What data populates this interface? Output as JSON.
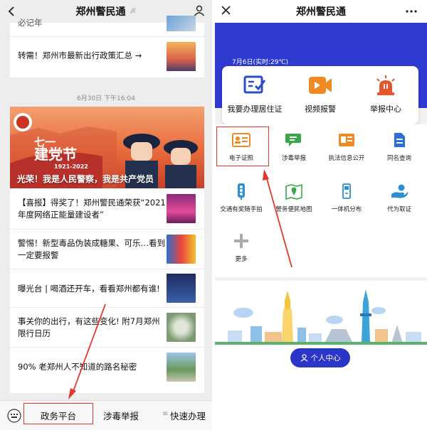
{
  "left": {
    "title": "郑州警民通",
    "partial_item": "必记年",
    "top_item": "转需！郑州市最新出行政策汇总 →",
    "timestamp": "6月30日 下午16:04",
    "banner": {
      "years": "1921-2022",
      "caption": "光荣！我是人民警察，我是共产党员"
    },
    "articles": [
      {
        "text": "【喜报】得奖了！郑州警民通荣获“2021年度网络正能量建设者”"
      },
      {
        "text": "警惕！新型毒品伪装成糖果、可乐…看到一定要报警"
      },
      {
        "text": "曝光台 | 喝酒还开车，看看郑州都有谁!"
      },
      {
        "text": "事关你的出行，有这些变化! 附7月郑州限行日历"
      },
      {
        "text": "90% 老郑州人不知道的路名秘密"
      }
    ],
    "bottom": {
      "item1": "政务平台",
      "item2": "涉毒举报",
      "item3": "快速办理"
    }
  },
  "right": {
    "title": "郑州警民通",
    "weather": "7月6日(实时:29℃)",
    "quick": [
      {
        "label": "我要办理居住证",
        "icon": "id-check-icon"
      },
      {
        "label": "视频报警",
        "icon": "video-camera-icon"
      },
      {
        "label": "举报中心",
        "icon": "alarm-light-icon"
      }
    ],
    "grid": [
      {
        "label": "电子证照",
        "icon": "id-card-icon"
      },
      {
        "label": "涉毒举报",
        "icon": "chat-report-icon"
      },
      {
        "label": "执法信息公开",
        "icon": "info-card-icon"
      },
      {
        "label": "同名查询",
        "icon": "document-search-icon"
      },
      {
        "label": "交通有奖随手拍",
        "icon": "traffic-light-icon"
      },
      {
        "label": "警务便民地图",
        "icon": "map-pin-icon"
      },
      {
        "label": "一体机分布",
        "icon": "kiosk-icon"
      },
      {
        "label": "代为取证",
        "icon": "hand-evidence-icon"
      },
      {
        "label": "更多",
        "icon": "plus-icon"
      }
    ],
    "personal_center": "个人中心"
  },
  "colors": {
    "accent_blue": "#2f3ad0",
    "highlight_red": "#e0392b",
    "orange": "#f08a24"
  }
}
